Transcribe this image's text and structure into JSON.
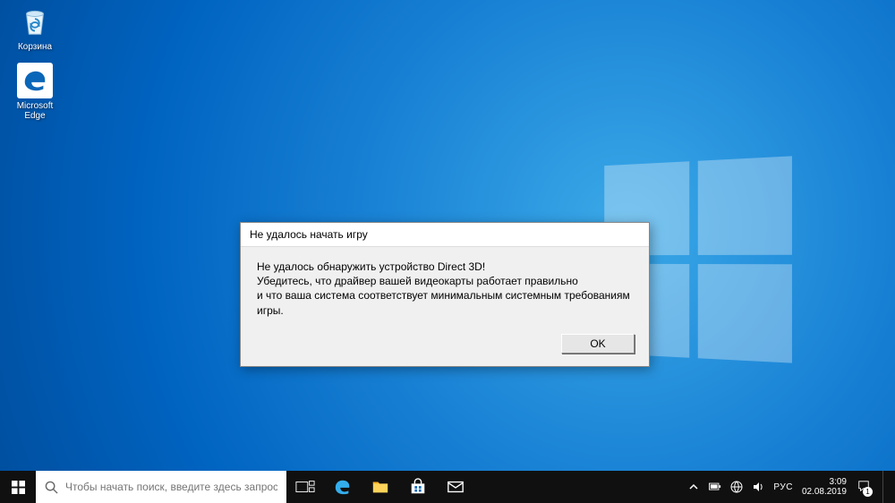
{
  "desktop": {
    "recycle_label": "Корзина",
    "edge_label": "Microsoft Edge"
  },
  "dialog": {
    "title": "Не удалось начать игру",
    "line1": "Не удалось обнаружить устройство Direct 3D!",
    "line2": "Убедитесь, что драйвер вашей видеокарты работает правильно",
    "line3": "и что ваша система соответствует минимальным системным требованиям игры.",
    "ok_label": "OK"
  },
  "taskbar": {
    "search_placeholder": "Чтобы начать поиск, введите здесь запрос"
  },
  "tray": {
    "language": "РУС",
    "time": "3:09",
    "date": "02.08.2019",
    "notification_count": "1"
  }
}
